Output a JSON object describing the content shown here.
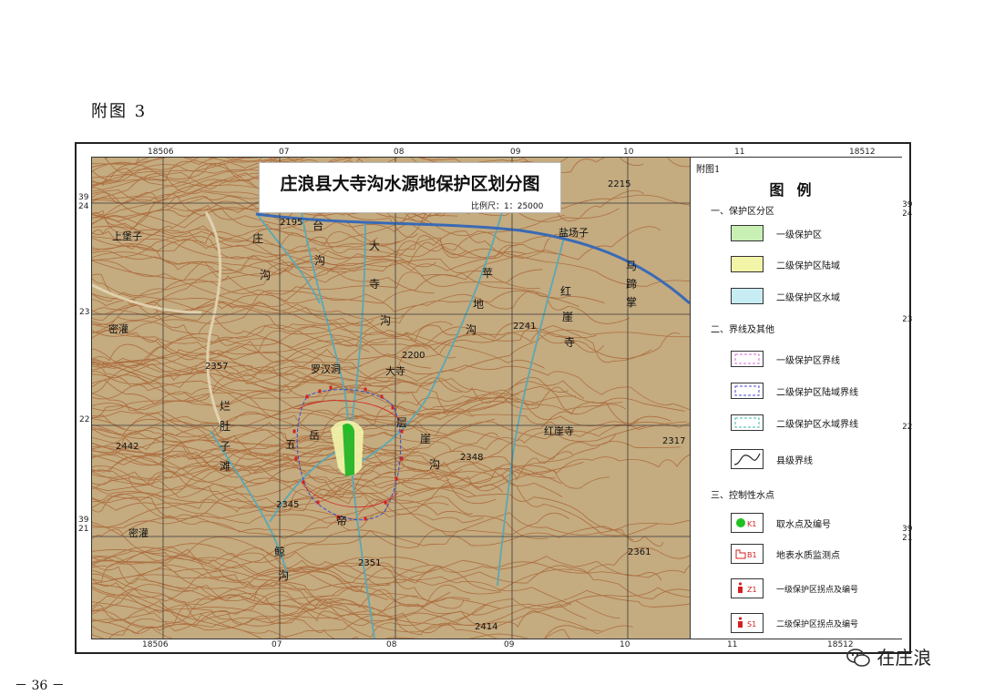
{
  "figure_label": "附图 3",
  "page_number": "－ 36 －",
  "watermark": "在庄浪",
  "watermark_icon": "wechat-icon",
  "map": {
    "title": "庄浪县大寺沟水源地保护区划分图",
    "scale": "比例尺：1：25000",
    "top_coords": [
      "18506",
      "07",
      "08",
      "09",
      "10",
      "11",
      "18512"
    ],
    "bottom_coords": [
      "18506",
      "07",
      "08",
      "09",
      "10",
      "11",
      "18512"
    ],
    "left_coords": [
      "3924",
      "23",
      "22",
      "3921"
    ],
    "right_coords": [
      "3924",
      "23",
      "22",
      "3921"
    ],
    "place_names": [
      "上堡子",
      "庄",
      "沟",
      "台",
      "沟",
      "大",
      "寺",
      "沟",
      "苹",
      "地",
      "沟",
      "盐场子",
      "马",
      "蹄",
      "掌",
      "红",
      "崖",
      "寺",
      "密灌",
      "罗汉洞",
      "大寺",
      "层",
      "崖",
      "沟",
      "五",
      "岳",
      "红崖寺",
      "烂",
      "肚",
      "子",
      "滩",
      "帝",
      "鲸",
      "沟",
      "密灌"
    ],
    "elevations": [
      "2195",
      "2215",
      "2200",
      "2241",
      "2357",
      "2442",
      "2348",
      "2317",
      "2345",
      "2351",
      "2361",
      "2414"
    ],
    "features_colors": {
      "terrain": "#c4ab80",
      "contour": "#a55a2a",
      "grid": "#3a3a3a",
      "river": "#5aa8b4",
      "boundary_red": "#d42020",
      "boundary_blue": "#3050d0",
      "primary_zone": "#2db82d"
    }
  },
  "legend": {
    "tag": "附图1",
    "title": "图例",
    "sections": [
      {
        "heading": "一、保护区分区",
        "items": [
          {
            "label": "一级保护区",
            "color": "#c9f0b4",
            "type": "fill"
          },
          {
            "label": "二级保护区陆域",
            "color": "#f2f4a8",
            "type": "fill"
          },
          {
            "label": "二级保护区水域",
            "color": "#c8ecf4",
            "type": "fill"
          }
        ]
      },
      {
        "heading": "二、界线及其他",
        "items": [
          {
            "label": "一级保护区界线",
            "color": "#d86ad8",
            "type": "dash"
          },
          {
            "label": "二级保护区陆域界线",
            "color": "#4a4ad8",
            "type": "dash"
          },
          {
            "label": "二级保护区水域界线",
            "color": "#3ab8b0",
            "type": "dash"
          },
          {
            "label": "县级界线",
            "color": "#222222",
            "type": "curve"
          }
        ]
      },
      {
        "heading": "三、控制性水点",
        "items": [
          {
            "label": "取水点及编号",
            "code": "K1",
            "color": "#20c020",
            "type": "dot"
          },
          {
            "label": "地表水质监测点",
            "code": "B1",
            "color": "#d42020",
            "type": "monitor"
          },
          {
            "label": "一级保护区拐点及编号",
            "code": "Z1",
            "color": "#d42020",
            "type": "marker"
          },
          {
            "label": "二级保护区拐点及编号",
            "code": "S1",
            "color": "#d42020",
            "type": "marker"
          }
        ]
      }
    ]
  }
}
